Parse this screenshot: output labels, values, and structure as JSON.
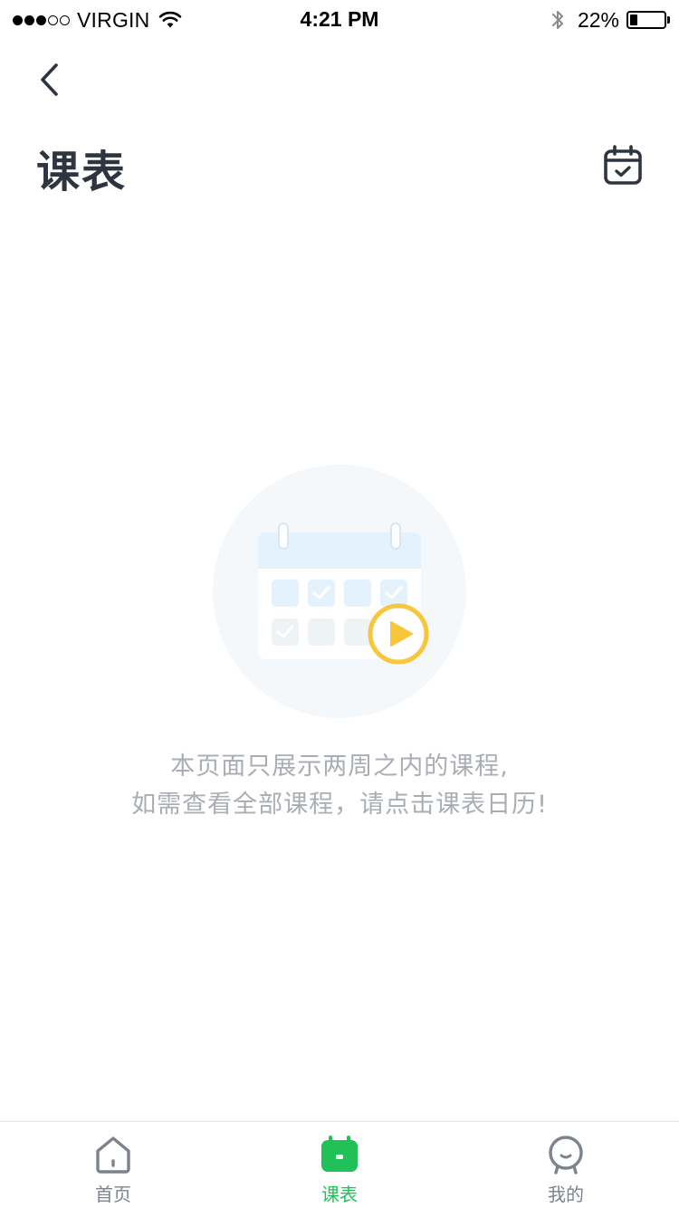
{
  "status_bar": {
    "signal_dots_filled": 3,
    "signal_dots_total": 5,
    "carrier": "VIRGIN",
    "time": "4:21 PM",
    "battery_percent": "22%",
    "battery_level": 0.22
  },
  "header": {
    "back_icon": "chevron-left-icon",
    "title": "课表",
    "calendar_icon": "calendar-check-icon"
  },
  "empty_state": {
    "illustration_icon": "calendar-play-icon",
    "line1": "本页面只展示两周之内的课程,",
    "line2": "如需查看全部课程，请点击课表日历!"
  },
  "tab_bar": {
    "active_tab": "课表",
    "active_color": "#21c15a",
    "inactive_color": "#7d838c",
    "tabs": [
      {
        "label": "首页",
        "icon": "home-icon"
      },
      {
        "label": "课表",
        "icon": "schedule-icon"
      },
      {
        "label": "我的",
        "icon": "profile-icon"
      }
    ]
  }
}
